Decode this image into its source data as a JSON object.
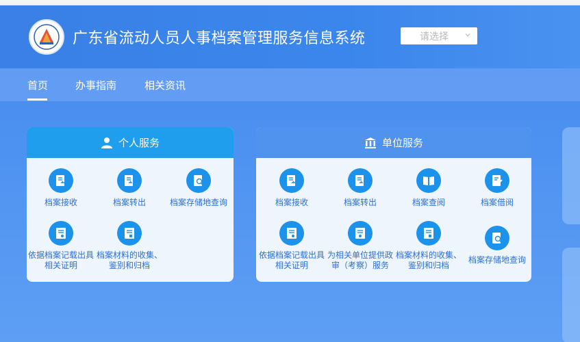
{
  "header": {
    "site_title": "广东省流动人员人事档案管理服务信息系统",
    "region_select": {
      "placeholder": "请选择"
    }
  },
  "nav": {
    "items": [
      {
        "label": "首页",
        "active": true
      },
      {
        "label": "办事指南",
        "active": false
      },
      {
        "label": "相关资讯",
        "active": false
      }
    ]
  },
  "personal": {
    "title": "个人服务",
    "icon": "user-icon",
    "items": [
      {
        "label": "档案接收",
        "icon": "archive-receive-icon"
      },
      {
        "label": "档案转出",
        "icon": "archive-transfer-out-icon"
      },
      {
        "label": "档案存储地查询",
        "icon": "archive-location-search-icon"
      },
      {
        "label": "依据档案记载出具\n相关证明",
        "icon": "certificate-icon"
      },
      {
        "label": "档案材料的收集、\n鉴别和归档",
        "icon": "archive-collect-icon"
      }
    ]
  },
  "unit": {
    "title": "单位服务",
    "icon": "bank-icon",
    "items": [
      {
        "label": "档案接收",
        "icon": "archive-receive-icon"
      },
      {
        "label": "档案转出",
        "icon": "archive-transfer-out-icon"
      },
      {
        "label": "档案查阅",
        "icon": "archive-read-icon"
      },
      {
        "label": "档案借阅",
        "icon": "archive-borrow-icon"
      },
      {
        "label": "依据档案记载出具\n相关证明",
        "icon": "certificate-icon"
      },
      {
        "label": "为相关单位提供政\n审（考察）服务",
        "icon": "political-review-icon"
      },
      {
        "label": "档案材料的收集、\n鉴别和归档",
        "icon": "archive-collect-icon"
      },
      {
        "label": "档案存储地查询",
        "icon": "archive-location-search-icon"
      }
    ]
  },
  "colors": {
    "header_bg": "#3a80e6",
    "personal_head": "#1f9eee",
    "unit_head": "#4f93ef",
    "icon_bg": "#1d92ea",
    "label_text": "#2c6fd6"
  }
}
